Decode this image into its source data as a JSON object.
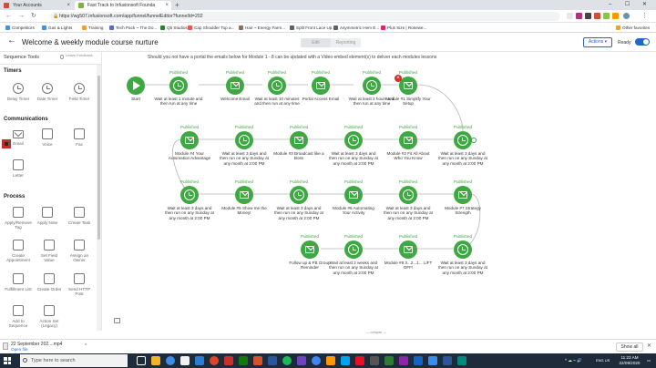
{
  "browser": {
    "tabs": [
      {
        "title": "Your Accounts",
        "active": false
      },
      {
        "title": "Fast Track to Infusionsoft Founda",
        "active": true
      }
    ],
    "new_tab": "+",
    "url": "https://wg507.infusionsoft.com/app/funnel/funnelEditor?funnelId=202",
    "bookmarks": [
      "Competitors",
      "Gas & Lights",
      "Training",
      "Tech Pack ~ The Do...",
      "Qb Studios",
      "Cap Shoulder Top a...",
      "Hair ~ Energy Farm...",
      "Split Front Lace Up...",
      "Asymmetric Hem E...",
      "Plus Size | Rosewe..."
    ],
    "other_bookmarks": "Other favorites",
    "win_controls": [
      "–",
      "☐",
      "✕"
    ]
  },
  "header": {
    "back": "←",
    "title": "Welcome & weekly module course nurture",
    "mode_edit": "Edit",
    "mode_reporting": "Reporting",
    "actions": "Actions ▾",
    "ready": "Ready"
  },
  "panel": {
    "tab_tools": "Sequence Tools",
    "tab_feedback": "Leave Feedback",
    "sections": {
      "timers": "Timers",
      "communications": "Communications",
      "process": "Process"
    },
    "timers": [
      "Delay Timer",
      "Date Timer",
      "Field Timer"
    ],
    "communications": [
      "Email",
      "Voice",
      "Fax",
      "Letter"
    ],
    "process": [
      "Apply/Remove Tag",
      "Apply Note",
      "Create Task",
      "Create Appointment",
      "Set Field Value",
      "Assign an Owner",
      "Fulfillment List",
      "Create Order",
      "Send HTTP Post",
      "Add to Sequence",
      "Action Set (Legacy)"
    ]
  },
  "canvas": {
    "instruction": "Should you not have a portal the emails below for Module 1 - 8 can be updated with a Video embed element(s) to deliver each modules lessons",
    "nodes": {
      "start": {
        "status": "",
        "label": "Start"
      },
      "r1n2": {
        "status": "Published",
        "label": "Wait at least 1 minute and then run at any time"
      },
      "r1n3": {
        "status": "Published",
        "label": "Welcome Email"
      },
      "r1n4": {
        "status": "Published",
        "label": "Wait at least 10 minutes and then run at any time"
      },
      "r1n5": {
        "status": "Published",
        "label": "Portal Access Email"
      },
      "r1n6": {
        "status": "Published",
        "label": "Wait at least 2 hours and then run at any time"
      },
      "r1n7": {
        "status": "Published",
        "label": "Module #1 Simplify Your Setup"
      },
      "r2n1": {
        "status": "Published",
        "label": "Wait at least 3 days and then run on any Sunday at any month at 2:00 PM"
      },
      "r2n2": {
        "status": "Published",
        "label": "Module #2 Fit All About Who You Know"
      },
      "r2n3": {
        "status": "Published",
        "label": "Wait at least 3 days and then run on any Sunday at any month at 2:00 PM"
      },
      "r2n4": {
        "status": "Published",
        "label": "Module #3 Broadcast like a Boss"
      },
      "r2n5": {
        "status": "Published",
        "label": "Wait at least 3 days and then run on any Sunday at any month at 2:00 PM"
      },
      "r2n6": {
        "status": "Published",
        "label": "Module #4 Your Automation Advantage"
      },
      "r3n1": {
        "status": "Published",
        "label": "Wait at least 3 days and then run on any Sunday at any month at 2:00 PM"
      },
      "r3n2": {
        "status": "Published",
        "label": "Module #5 Show me the Money!"
      },
      "r3n3": {
        "status": "Published",
        "label": "Wait at least 3 days and then run on any Sunday at any month at 2:00 PM"
      },
      "r3n4": {
        "status": "Published",
        "label": "Module #6 Automating Your Activity"
      },
      "r3n5": {
        "status": "Published",
        "label": "Wait at least 3 days and then run on any Sunday at any month at 2:00 PM"
      },
      "r3n6": {
        "status": "Published",
        "label": "Module #7 Strategy Strength"
      },
      "r4n1": {
        "status": "Published",
        "label": "Wait at least 3 days and then run on any Sunday at any month at 2:00 PM"
      },
      "r4n2": {
        "status": "Published",
        "label": "Module #8 3...2...1... LIFT OFF!"
      },
      "r4n3": {
        "status": "Published",
        "label": "Wait at least 2 weeks and then run on any Sunday at any month at 2:00 PM"
      },
      "r4n4": {
        "status": "Published",
        "label": "Follow up & FB Group Reminder"
      }
    },
    "footer_hint": "— collapse —"
  },
  "downloads": {
    "file": "22 September 202....mp4",
    "open": "Open file",
    "caret": "^",
    "show_all": "Show all",
    "close": "✕"
  },
  "taskbar": {
    "search_placeholder": "Type here to search",
    "lang": "ENG US",
    "time": "11:23 AM",
    "date": "22/09/2020"
  },
  "colors": {
    "node_green": "#3ea843",
    "accent_blue": "#1e66d0",
    "delete_red": "#d0342c"
  }
}
